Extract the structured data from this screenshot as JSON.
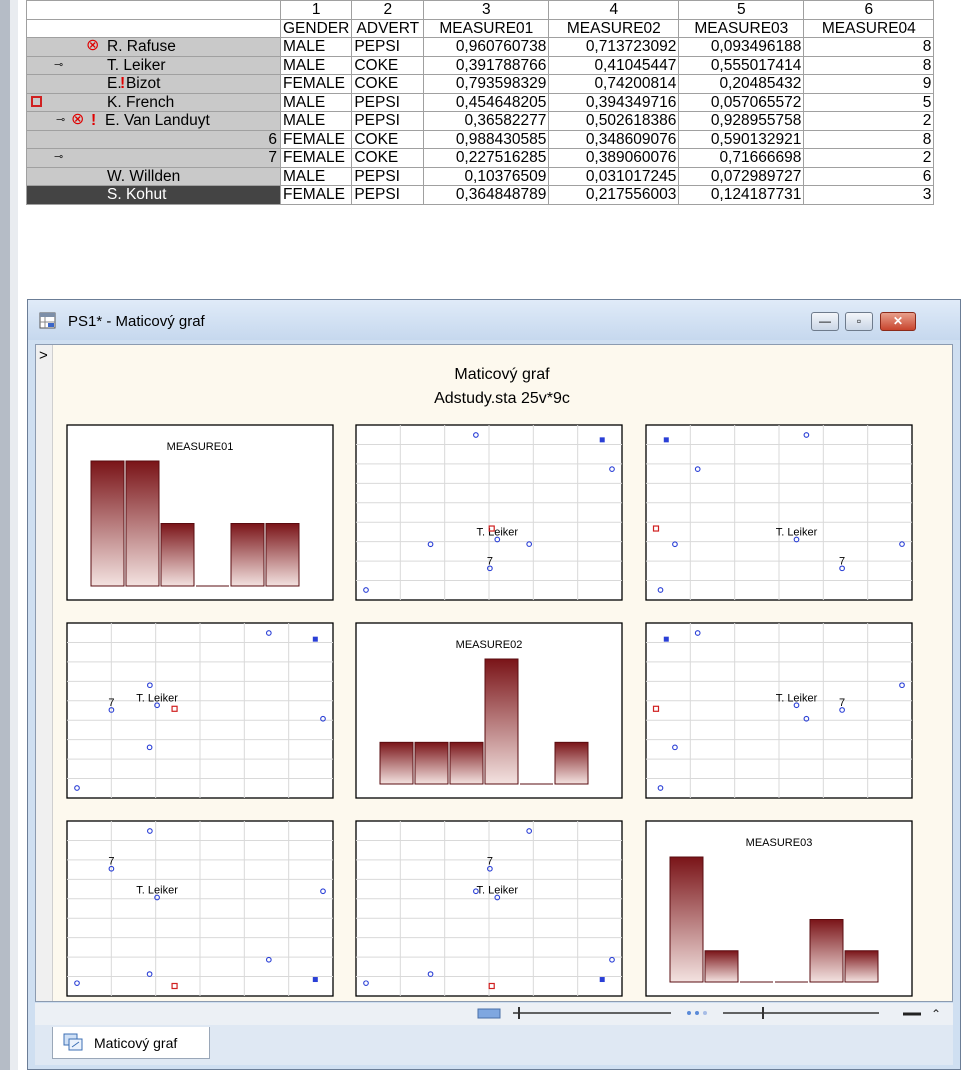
{
  "spreadsheet": {
    "columns": [
      {
        "num": "1",
        "name": "GENDER"
      },
      {
        "num": "2",
        "name": "ADVERT"
      },
      {
        "num": "3",
        "name": "MEASURE01"
      },
      {
        "num": "4",
        "name": "MEASURE02"
      },
      {
        "num": "5",
        "name": "MEASURE03"
      },
      {
        "num": "6",
        "name": "MEASURE04"
      }
    ],
    "rows": [
      {
        "label": "R. Rafuse",
        "num": "",
        "markers": [
          "excluded-icon"
        ],
        "cells": [
          "MALE",
          "PEPSI",
          "0,960760738",
          "0,713723092",
          "0,093496188",
          "8"
        ]
      },
      {
        "label": "T. Leiker",
        "num": "",
        "markers": [
          "labeled-icon"
        ],
        "cells": [
          "MALE",
          "COKE",
          "0,391788766",
          "0,41045447",
          "0,555017414",
          "8"
        ]
      },
      {
        "label": "E. Bizot",
        "num": "",
        "markers": [
          "highlight-icon"
        ],
        "cells": [
          "FEMALE",
          "COKE",
          "0,793598329",
          "0,74200814",
          "0,20485432",
          "9"
        ]
      },
      {
        "label": "K. French",
        "num": "",
        "markers": [
          "square-marker-icon"
        ],
        "cells": [
          "MALE",
          "PEPSI",
          "0,454648205",
          "0,394349716",
          "0,057065572",
          "5"
        ]
      },
      {
        "label": "E. Van Landuyt",
        "num": "",
        "markers": [
          "labeled-icon",
          "excluded-icon",
          "highlight-icon"
        ],
        "cells": [
          "MALE",
          "PEPSI",
          "0,36582277",
          "0,502618386",
          "0,928955758",
          "2"
        ]
      },
      {
        "label": "",
        "num": "6",
        "markers": [],
        "cells": [
          "FEMALE",
          "COKE",
          "0,988430585",
          "0,348609076",
          "0,590132921",
          "8"
        ]
      },
      {
        "label": "",
        "num": "7",
        "markers": [
          "labeled-icon"
        ],
        "cells": [
          "FEMALE",
          "COKE",
          "0,227516285",
          "0,389060076",
          "0,71666698",
          "2"
        ]
      },
      {
        "label": "W. Willden",
        "num": "",
        "markers": [],
        "cells": [
          "MALE",
          "PEPSI",
          "0,10376509",
          "0,031017245",
          "0,072989727",
          "6"
        ]
      },
      {
        "label": "S. Kohut",
        "num": "",
        "markers": [],
        "selected": true,
        "cells": [
          "FEMALE",
          "PEPSI",
          "0,364848789",
          "0,217556003",
          "0,124187731",
          "3"
        ]
      }
    ]
  },
  "window": {
    "title": "PS1* - Maticový graf",
    "gutter_label": ">"
  },
  "tab": {
    "label": "Maticový graf"
  },
  "colors": {
    "bar_dark": "#7a1418",
    "bar_light": "#f3e2e0",
    "point_normal": "#2a3fd6",
    "point_excluded": "#d02020",
    "plot_background": "#fdf9ee"
  },
  "chart_data": {
    "type": "scatter-matrix",
    "title": "Maticový graf",
    "subtitle": "Adstudy.sta 25v*9c",
    "variables": [
      "MEASURE01",
      "MEASURE02",
      "MEASURE03"
    ],
    "grid": true,
    "point_labels": {
      "1": "T. Leiker",
      "6": "7"
    },
    "points": [
      {
        "MEASURE01": 0.960760738,
        "MEASURE02": 0.713723092,
        "MEASURE03": 0.093496188,
        "style": "filled"
      },
      {
        "MEASURE01": 0.391788766,
        "MEASURE02": 0.41045447,
        "MEASURE03": 0.555017414,
        "style": "circle"
      },
      {
        "MEASURE01": 0.793598329,
        "MEASURE02": 0.74200814,
        "MEASURE03": 0.20485432,
        "style": "circle"
      },
      {
        "MEASURE01": 0.454648205,
        "MEASURE02": 0.394349716,
        "MEASURE03": 0.057065572,
        "style": "square"
      },
      {
        "MEASURE01": 0.36582277,
        "MEASURE02": 0.502618386,
        "MEASURE03": 0.928955758,
        "style": "circle"
      },
      {
        "MEASURE01": 0.988430585,
        "MEASURE02": 0.348609076,
        "MEASURE03": 0.590132921,
        "style": "circle"
      },
      {
        "MEASURE01": 0.227516285,
        "MEASURE02": 0.389060076,
        "MEASURE03": 0.71666698,
        "style": "circle"
      },
      {
        "MEASURE01": 0.10376509,
        "MEASURE02": 0.031017245,
        "MEASURE03": 0.072989727,
        "style": "circle"
      },
      {
        "MEASURE01": 0.364848789,
        "MEASURE02": 0.217556003,
        "MEASURE03": 0.124187731,
        "style": "circle"
      }
    ],
    "histograms": {
      "MEASURE01": [
        2,
        2,
        1,
        0,
        1,
        1
      ],
      "MEASURE02": [
        1,
        1,
        1,
        3,
        0,
        1
      ],
      "MEASURE03": [
        4,
        1,
        0,
        0,
        2,
        1
      ]
    }
  }
}
